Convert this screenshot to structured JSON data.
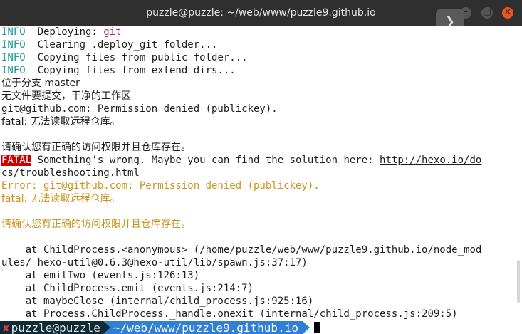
{
  "window": {
    "title": "puzzle@puzzle: ~/web/www/puzzle9.github.io",
    "min_symbol": "–",
    "max_symbol": "□",
    "close_symbol": "×",
    "overlay_symbol": "❯"
  },
  "terminal": {
    "lines": [
      {
        "tag": "INFO",
        "text": "  Deploying: ",
        "accent": "git"
      },
      {
        "tag": "INFO",
        "text": "  Clearing .deploy_git folder..."
      },
      {
        "tag": "INFO",
        "text": "  Copying files from public folder..."
      },
      {
        "tag": "INFO",
        "text": "  Copying files from extend dirs..."
      },
      {
        "text": "位于分支 master"
      },
      {
        "text": "无文件要提交，干净的工作区"
      },
      {
        "text": "git@github.com: Permission denied (publickey)."
      },
      {
        "text": "fatal: 无法读取远程仓库。"
      },
      {
        "text": ""
      },
      {
        "text": "请确认您有正确的访问权限并且仓库存在。"
      },
      {
        "fatal_tag": "FATAL",
        "text": " Something's wrong. Maybe you can find the solution here: ",
        "link": "http://hexo.io/do"
      },
      {
        "link": "cs/troubleshooting.html"
      },
      {
        "text": "Error: git@github.com: Permission denied (publickey).",
        "color": "amber"
      },
      {
        "text": "fatal: 无法读取远程仓库。",
        "color": "amber"
      },
      {
        "text": ""
      },
      {
        "text": "请确认您有正确的访问权限并且仓库存在。",
        "color": "amber"
      },
      {
        "text": ""
      },
      {
        "text": "    at ChildProcess.<anonymous> (/home/puzzle/web/www/puzzle9.github.io/node_mod"
      },
      {
        "text": "ules/_hexo-util@0.6.3@hexo-util/lib/spawn.js:37:17)"
      },
      {
        "text": "    at emitTwo (events.js:126:13)"
      },
      {
        "text": "    at ChildProcess.emit (events.js:214:7)"
      },
      {
        "text": "    at maybeClose (internal/child_process.js:925:16)"
      },
      {
        "text": "    at Process.ChildProcess._handle.onexit (internal/child_process.js:209:5)"
      }
    ]
  },
  "prompt": {
    "fail_mark": "✘",
    "user_host": "puzzle@puzzle",
    "cwd": "~/web/www/puzzle9.github.io"
  },
  "colors": {
    "info": "#1c9a8f",
    "accent": "#b1279a",
    "amber": "#c8941c",
    "fatal_bg": "#cc0000",
    "prompt_dark": "#0e2a36",
    "prompt_blue": "#2f7fd3"
  }
}
